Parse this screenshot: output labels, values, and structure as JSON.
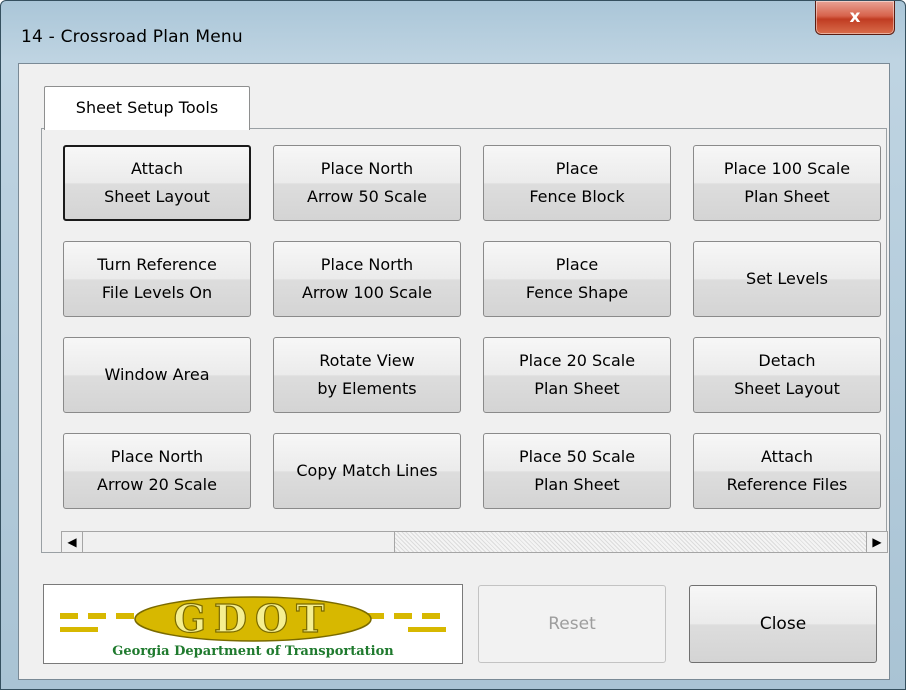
{
  "window": {
    "title": "14 - Crossroad Plan Menu",
    "close_glyph": "x"
  },
  "tabs": [
    {
      "label": "Sheet Setup Tools",
      "selected": true
    }
  ],
  "buttons": [
    [
      "Attach\nSheet Layout",
      "Place North\nArrow 50 Scale",
      "Place\nFence Block",
      "Place 100 Scale\nPlan Sheet"
    ],
    [
      "Turn Reference\nFile Levels On",
      "Place North\nArrow 100 Scale",
      "Place\nFence Shape",
      "Set Levels"
    ],
    [
      "Window Area",
      "Rotate View\nby Elements",
      "Place 20 Scale\nPlan Sheet",
      "Detach\nSheet Layout"
    ],
    [
      "Place North\nArrow 20 Scale",
      "Copy Match Lines",
      "Place 50 Scale\nPlan Sheet",
      "Attach\nReference Files"
    ]
  ],
  "scrollbar": {
    "left_arrow": "◀",
    "right_arrow": "▶"
  },
  "logo": {
    "text": "GDOT",
    "caption": "Georgia Department of Transportation"
  },
  "footer": {
    "reset_label": "Reset",
    "reset_enabled": false,
    "close_label": "Close"
  },
  "colors": {
    "logo_gold": "#d7b800",
    "logo_green": "#1f7a2e",
    "close_red": "#c8432a"
  }
}
